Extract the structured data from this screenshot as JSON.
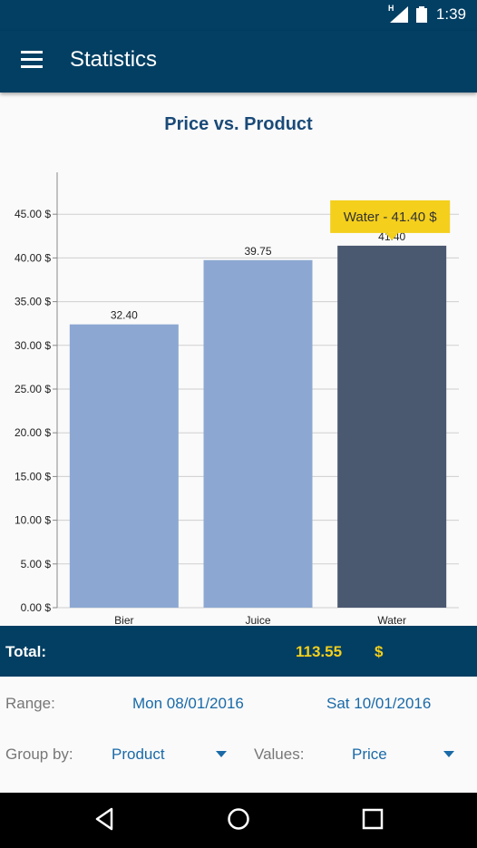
{
  "status": {
    "time": "1:39",
    "network": "H"
  },
  "app": {
    "title": "Statistics"
  },
  "chart_data": {
    "type": "bar",
    "title": "Price vs. Product",
    "categories": [
      "Bier",
      "Juice",
      "Water"
    ],
    "values": [
      32.4,
      39.75,
      41.4
    ],
    "value_labels": [
      "32.40",
      "39.75",
      "41.40"
    ],
    "y_ticks": [
      "0.00 $",
      "5.00 $",
      "10.00 $",
      "15.00 $",
      "20.00 $",
      "25.00 $",
      "30.00 $",
      "35.00 $",
      "40.00 $",
      "45.00 $"
    ],
    "ylim": [
      0,
      45
    ],
    "grid": true,
    "colors": {
      "bar": "#8ca8d2",
      "highlight": "#4a5870",
      "tooltip": "#f4cf1c"
    },
    "highlighted_index": 2,
    "tooltip": "Water - 41.40 $"
  },
  "total": {
    "label": "Total:",
    "value": "113.55",
    "currency": "$"
  },
  "filters": {
    "range_label": "Range:",
    "range_start": "Mon 08/01/2016",
    "range_end": "Sat 10/01/2016",
    "group_label": "Group by:",
    "group_value": "Product",
    "values_label": "Values:",
    "values_value": "Price"
  }
}
